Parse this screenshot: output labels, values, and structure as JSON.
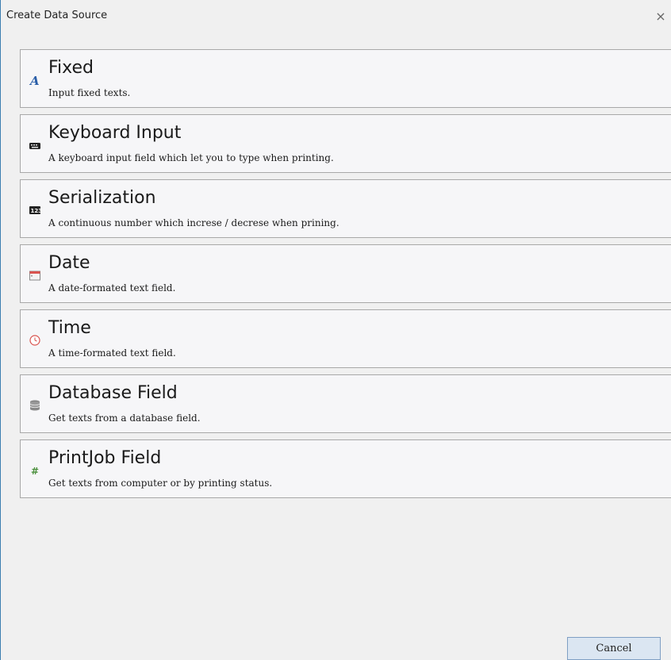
{
  "dialog": {
    "title": "Create Data Source",
    "close_symbol": "×",
    "cancel_label": "Cancel"
  },
  "items": [
    {
      "title": "Fixed",
      "desc": "Input fixed texts.",
      "icon": "letter-a-icon"
    },
    {
      "title": "Keyboard Input",
      "desc": "A keyboard input field which let you to type when printing.",
      "icon": "keyboard-icon"
    },
    {
      "title": "Serialization",
      "desc": "A continuous number which increse / decrese when prining.",
      "icon": "number-sequence-icon"
    },
    {
      "title": "Date",
      "desc": "A date-formated text field.",
      "icon": "calendar-icon"
    },
    {
      "title": "Time",
      "desc": "A time-formated text field.",
      "icon": "clock-icon"
    },
    {
      "title": "Database Field",
      "desc": "Get texts from a database field.",
      "icon": "database-icon"
    },
    {
      "title": "PrintJob Field",
      "desc": "Get texts from computer or by printing status.",
      "icon": "hash-icon"
    }
  ]
}
